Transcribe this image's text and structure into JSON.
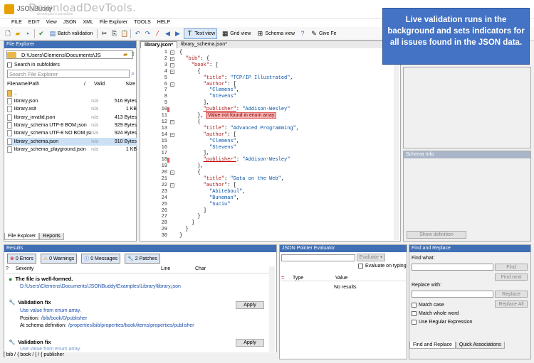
{
  "titlebar": {
    "title": "JSONBuddy",
    "watermark": "DownloadDevTools.",
    "watermark_sub": "developer's paradise"
  },
  "menu": [
    "FILE",
    "EDIT",
    "View",
    "JSON",
    "XML",
    "File Explorer",
    "TOOLS",
    "HELP"
  ],
  "toolbar": {
    "batch": "Batch validation",
    "text_view": "Text view",
    "grid_view": "Grid view",
    "schema_view": "Schema view",
    "give_fe": "Give Fe"
  },
  "callout": "Live validation runs in the background and sets indicators for all issues found in the JSON data.",
  "file_explorer": {
    "title": "File Explorer",
    "path": "D:\\Users\\Clemens\\Documents\\JS",
    "search_subfolders": "Search in subfolders",
    "search_placeholder": "Search File Explorer",
    "col_name": "Filename/Path",
    "col_valid": "Valid",
    "col_size": "Size",
    "updir": "..",
    "files": [
      {
        "name": "library.json",
        "valid": "n/a",
        "size": "516 Bytes"
      },
      {
        "name": "library.xslt",
        "valid": "n/a",
        "size": "1 KB"
      },
      {
        "name": "library_invalid.json",
        "valid": "n/a",
        "size": "413 Bytes"
      },
      {
        "name": "library_schema UTF-8 BOM.json",
        "valid": "n/a",
        "size": "929 Bytes"
      },
      {
        "name": "library_schema UTF-8 NO BOM.json",
        "valid": "n/a",
        "size": "924 Bytes"
      },
      {
        "name": "library_schema.json",
        "valid": "n/a",
        "size": "910 Bytes"
      },
      {
        "name": "library_schema_playground.json",
        "valid": "n/a",
        "size": "1 KB"
      }
    ],
    "tabs": [
      "File Explorer",
      "Reports"
    ]
  },
  "editor": {
    "tabs": [
      "library.json*",
      "library_schema.json*"
    ],
    "lines": [
      "{",
      "  \"bib\": {",
      "    \"book\": [",
      "      {",
      "        \"title\": \"TCP/IP Illustrated\",",
      "        \"author\": [",
      "          \"Clemens\",",
      "          \"Stevens\"",
      "        ],",
      "        \"publisher\": \"Addison-Wesley\"",
      "      },",
      "      {",
      "        \"title\": \"Advanced Programming\",",
      "        \"author\": [",
      "          \"Clemens\",",
      "          \"Stevens\"",
      "        ],",
      "        \"publisher\": \"Addison-Wesley\"",
      "      },",
      "      {",
      "        \"title\": \"Data on the Web\",",
      "        \"author\": [",
      "          \"Abiteboul\",",
      "          \"Buneman\",",
      "          \"Suciu\"",
      "        ]",
      "      }",
      "    ]",
      "  }",
      "}"
    ],
    "error_badge": "Value not found in enum array"
  },
  "schema_info": {
    "title": "Schema Info",
    "show_definition": "Show definition"
  },
  "results": {
    "title": "Results",
    "errors": "0 Errors",
    "warnings": "0 Warnings",
    "messages": "0 Messages",
    "patches": "2 Patches",
    "col_q": "?",
    "col_sev": "Severity",
    "col_line": "Line",
    "col_char": "Char",
    "wellformed": "The file is well-formed.",
    "wellformed_path": "D:\\Users\\Clemens\\Documents\\JSONBuddy\\Examples\\Library\\library.json",
    "fix1_title": "Validation fix",
    "fix1_desc": "Use value from enum array.",
    "fix1_pos_label": "Position:",
    "fix1_pos": "/bib/book/0/publisher",
    "fix1_def_label": "At schema definition:",
    "fix1_def": "/properties/bib/properties/book/items/properties/publisher",
    "apply": "Apply",
    "fix2_title": "Validation fix",
    "fix2_desc": "Use value from enum array."
  },
  "status": "[ bib / { book / [ / { publisher",
  "json_pointer": {
    "title": "JSON Pointer Evaluator",
    "evaluate": "Evaluate",
    "on_typing": "Evaluate on typing",
    "col_type": "Type",
    "col_value": "Value",
    "no_results": "No results"
  },
  "find_replace": {
    "title": "Find and Replace",
    "find_what": "Find what:",
    "find": "Find",
    "find_next": "Find next",
    "replace_with": "Replace with:",
    "replace": "Replace",
    "replace_all": "Replace All",
    "match_case": "Match case",
    "match_whole": "Match whole word",
    "regex": "Use Regular Expression",
    "tabs": [
      "Find and Replace",
      "Quick Associations"
    ]
  }
}
